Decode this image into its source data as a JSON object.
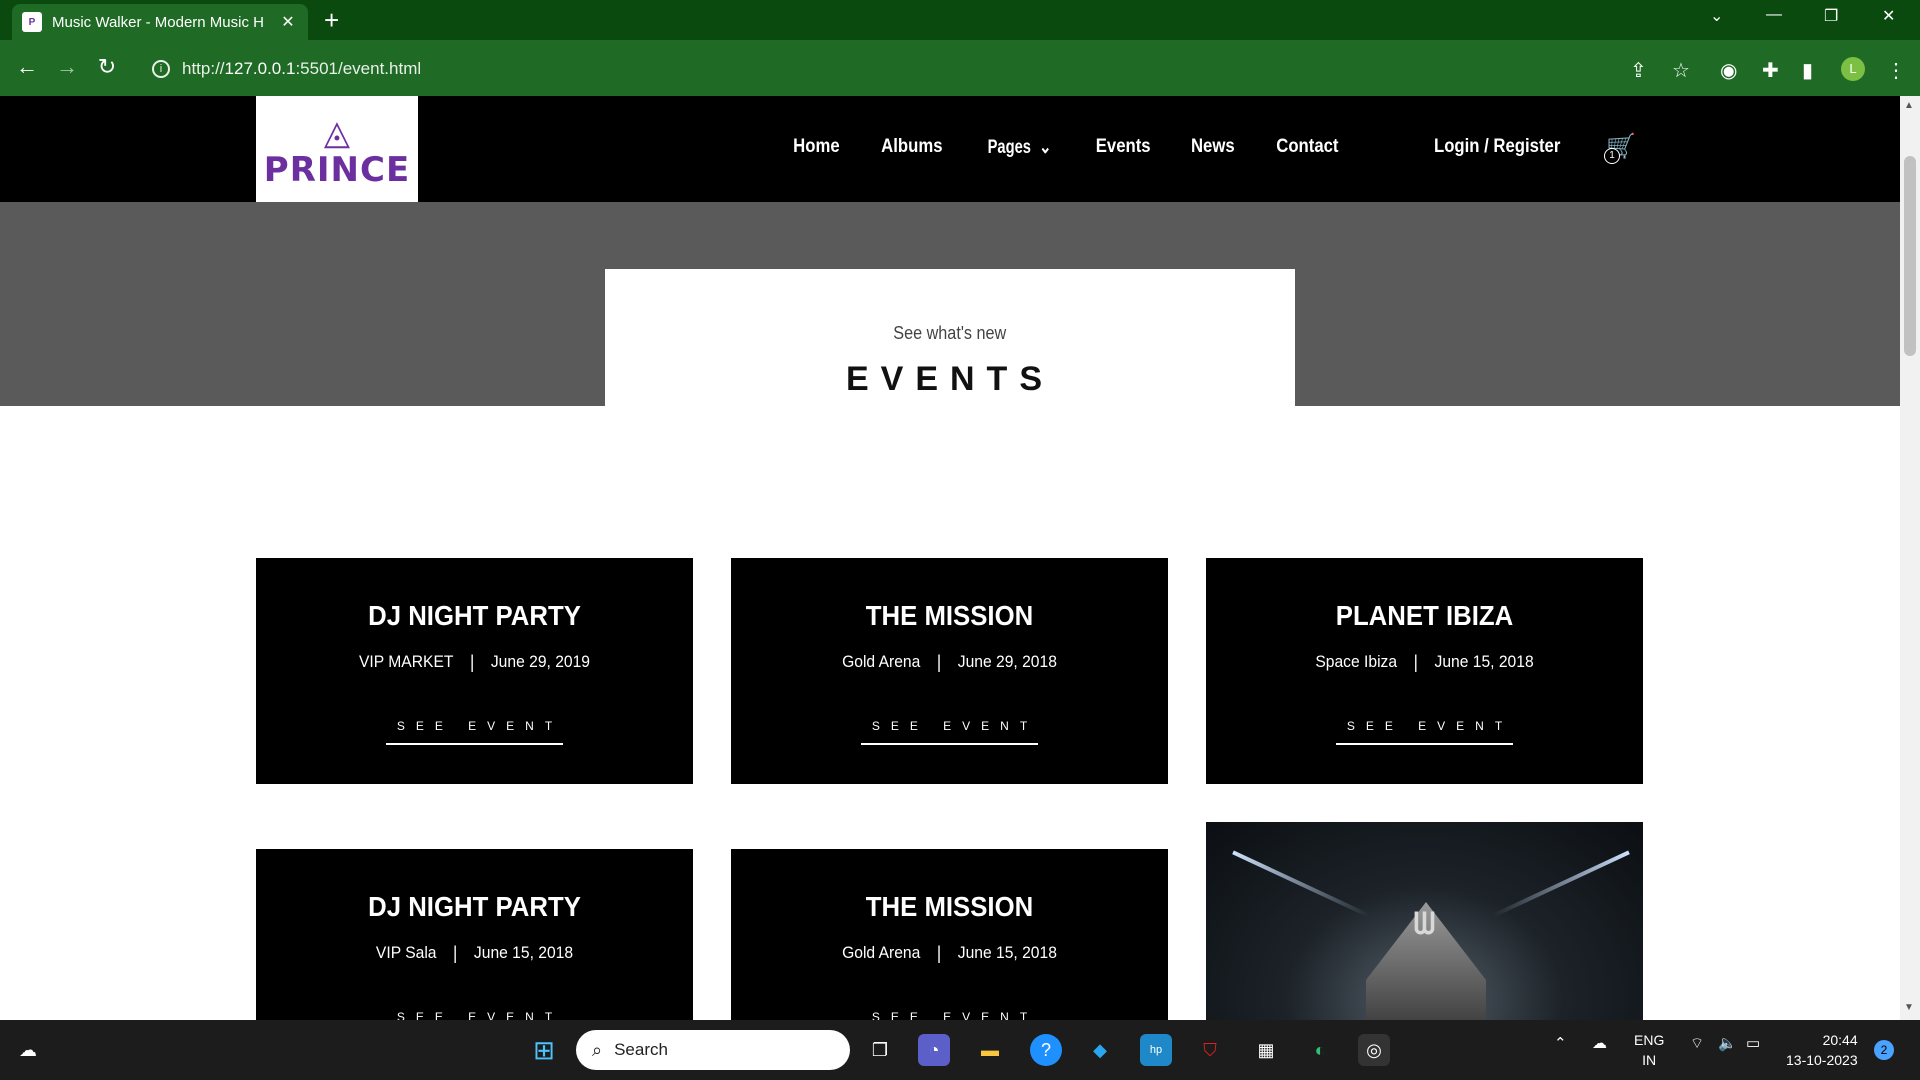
{
  "browser": {
    "tab_title": "Music Walker - Modern Music H",
    "favicon_text": "P",
    "url_prefix": "http://",
    "url_host": "127.0.0.1",
    "url_rest": ":5501/event.html",
    "profile_initial": "L"
  },
  "header": {
    "logo_text": "PRINCE",
    "nav": [
      "Home",
      "Albums",
      "Pages",
      "Events",
      "News",
      "Contact"
    ],
    "login": "Login / Register",
    "cart_count": "1"
  },
  "hero": {
    "subtitle": "See what's new",
    "title": "EVENTS"
  },
  "events": [
    {
      "name": "DJ NIGHT PARTY",
      "venue": "VIP MARKET",
      "date": "June 29, 2019",
      "cta": "SEE EVENT"
    },
    {
      "name": "THE MISSION",
      "venue": "Gold Arena",
      "date": "June 29, 2018",
      "cta": "SEE EVENT"
    },
    {
      "name": "PLANET IBIZA",
      "venue": "Space Ibiza",
      "date": "June 15, 2018",
      "cta": "SEE EVENT"
    },
    {
      "name": "DJ NIGHT PARTY",
      "venue": "VIP Sala",
      "date": "June 15, 2018",
      "cta": "SEE EVENT"
    },
    {
      "name": "THE MISSION",
      "venue": "Gold Arena",
      "date": "June 15, 2018",
      "cta": "SEE EVENT"
    }
  ],
  "taskbar": {
    "search_placeholder": "Search",
    "lang_top": "ENG",
    "lang_bottom": "IN",
    "time": "20:44",
    "date": "13-10-2023",
    "notification_count": "2"
  }
}
